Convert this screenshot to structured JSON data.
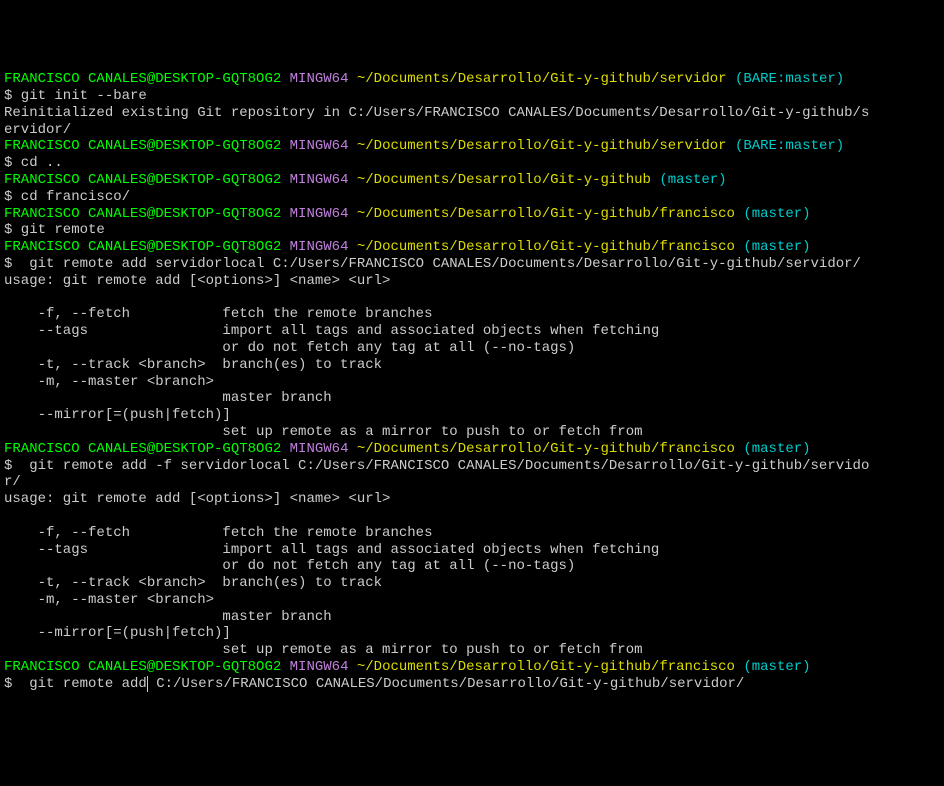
{
  "blocks": [
    {
      "user_host": "FRANCISCO CANALES@DESKTOP-GQT8OG2",
      "mingw": "MINGW64",
      "path": "~/Documents/Desarrollo/Git-y-github/servidor",
      "branch": "(BARE:master)",
      "command": "$ git init --bare",
      "output": "Reinitialized existing Git repository in C:/Users/FRANCISCO CANALES/Documents/Desarrollo/Git-y-github/s\nervidor/"
    },
    {
      "user_host": "FRANCISCO CANALES@DESKTOP-GQT8OG2",
      "mingw": "MINGW64",
      "path": "~/Documents/Desarrollo/Git-y-github/servidor",
      "branch": "(BARE:master)",
      "command": "$ cd ..",
      "output": ""
    },
    {
      "user_host": "FRANCISCO CANALES@DESKTOP-GQT8OG2",
      "mingw": "MINGW64",
      "path": "~/Documents/Desarrollo/Git-y-github",
      "branch": "(master)",
      "command": "$ cd francisco/",
      "output": ""
    },
    {
      "user_host": "FRANCISCO CANALES@DESKTOP-GQT8OG2",
      "mingw": "MINGW64",
      "path": "~/Documents/Desarrollo/Git-y-github/francisco",
      "branch": "(master)",
      "command": "$ git remote",
      "output": ""
    },
    {
      "user_host": "FRANCISCO CANALES@DESKTOP-GQT8OG2",
      "mingw": "MINGW64",
      "path": "~/Documents/Desarrollo/Git-y-github/francisco",
      "branch": "(master)",
      "command": "$  git remote add servidorlocal C:/Users/FRANCISCO CANALES/Documents/Desarrollo/Git-y-github/servidor/",
      "output": "usage: git remote add [<options>] <name> <url>\n\n    -f, --fetch           fetch the remote branches\n    --tags                import all tags and associated objects when fetching\n                          or do not fetch any tag at all (--no-tags)\n    -t, --track <branch>  branch(es) to track\n    -m, --master <branch>\n                          master branch\n    --mirror[=(push|fetch)]\n                          set up remote as a mirror to push to or fetch from\n"
    },
    {
      "user_host": "FRANCISCO CANALES@DESKTOP-GQT8OG2",
      "mingw": "MINGW64",
      "path": "~/Documents/Desarrollo/Git-y-github/francisco",
      "branch": "(master)",
      "command": "$  git remote add -f servidorlocal C:/Users/FRANCISCO CANALES/Documents/Desarrollo/Git-y-github/servido\nr/",
      "output": "usage: git remote add [<options>] <name> <url>\n\n    -f, --fetch           fetch the remote branches\n    --tags                import all tags and associated objects when fetching\n                          or do not fetch any tag at all (--no-tags)\n    -t, --track <branch>  branch(es) to track\n    -m, --master <branch>\n                          master branch\n    --mirror[=(push|fetch)]\n                          set up remote as a mirror to push to or fetch from\n"
    }
  ],
  "current": {
    "user_host": "FRANCISCO CANALES@DESKTOP-GQT8OG2",
    "mingw": "MINGW64",
    "path": "~/Documents/Desarrollo/Git-y-github/francisco",
    "branch": "(master)",
    "command_before_cursor": "$  git remote add",
    "command_after_cursor": " C:/Users/FRANCISCO CANALES/Documents/Desarrollo/Git-y-github/servidor/"
  }
}
